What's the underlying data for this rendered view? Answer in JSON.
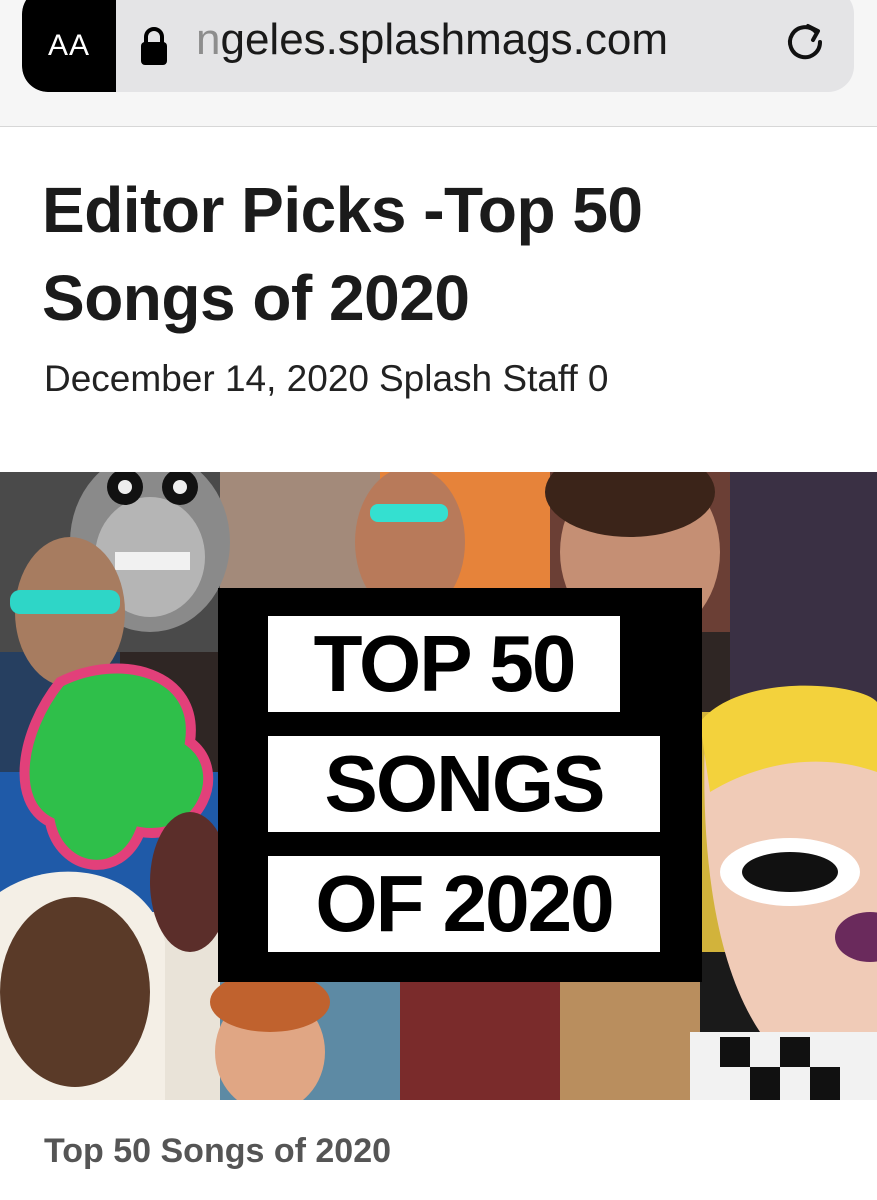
{
  "browser": {
    "reader_label": "AA",
    "url_partial_char": "n",
    "url_text": "geles.splashmags.com",
    "icons": [
      "reader-view-icon",
      "lock-icon",
      "reload-icon"
    ]
  },
  "article": {
    "title": "Editor Picks -Top 50 Songs of 2020",
    "date": "December 14, 2020",
    "author": "Splash Staff",
    "comment_count": "0"
  },
  "featured_image": {
    "badge_lines": [
      "TOP 50",
      "SONGS",
      "OF 2020"
    ]
  },
  "caption": "Top 50 Songs of 2020",
  "colors": {
    "address_bar": "#e4e4e6",
    "reader_button": "#000000",
    "title_text": "#1b1b1b",
    "caption_text": "#555555"
  }
}
